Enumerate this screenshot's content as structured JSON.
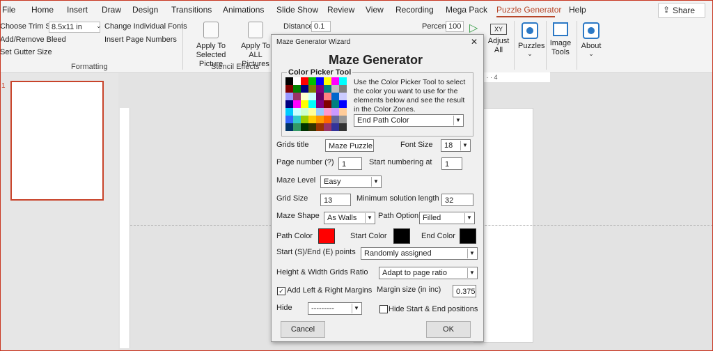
{
  "menubar": {
    "tabs": [
      "File",
      "Home",
      "Insert",
      "Draw",
      "Design",
      "Transitions",
      "Animations",
      "Slide Show",
      "Review",
      "View",
      "Recording",
      "Mega Pack",
      "Puzzle Generator",
      "Help"
    ],
    "active": "Puzzle Generator",
    "share": "Share"
  },
  "ribbon": {
    "trim_size_label": "Choose Trim Size",
    "trim_size_value": "8.5x11 in",
    "change_fonts": "Change Individual Fonts",
    "add_remove_bleed": "Add/Remove Bleed",
    "insert_page_numbers": "Insert Page Numbers",
    "set_gutter_size": "Set Gutter Size",
    "formatting_group": "Formatting",
    "apply_selected": "Apply To Selected Picture",
    "apply_all": "Apply To ALL Pictures",
    "stencil_group": "Stencil Effects",
    "distance_label": "Distance",
    "distance_value": "0.1",
    "percent_label": "Percent",
    "percent_value": "100",
    "adjust_all": "Adjust All",
    "xy_icon": "XY",
    "puzzles": "Puzzles",
    "image_tools": "Image Tools",
    "about": "About"
  },
  "slide_panel": {
    "number": "1"
  },
  "ruler": {
    "marks": "· 3 · · · 4"
  },
  "dialog": {
    "window_title": "Maze Generator Wizard",
    "close_glyph": "✕",
    "heading": "Maze Generator",
    "color_picker": {
      "group_label": "Color Picker Tool",
      "instructions": "Use the Color Picker Tool to select the color you want to use for the elements below and see the result in the Color Zones.",
      "target_value": "End Path Color"
    },
    "grids_title_label": "Grids title",
    "grids_title_value": "Maze Puzzle",
    "font_size_label": "Font Size",
    "font_size_value": "18",
    "page_number_label": "Page number (?)",
    "page_number_value": "1",
    "start_numbering_label": "Start numbering at",
    "start_numbering_value": "1",
    "maze_level_label": "Maze Level",
    "maze_level_value": "Easy",
    "grid_size_label": "Grid Size",
    "grid_size_value": "13",
    "min_solution_label": "Minimum solution length",
    "min_solution_value": "32",
    "maze_shape_label": "Maze Shape",
    "maze_shape_value": "As Walls",
    "path_option_label": "Path Option",
    "path_option_value": "Filled",
    "path_color_label": "Path Color",
    "path_color": "#ff0000",
    "start_color_label": "Start Color",
    "start_color": "#000000",
    "end_color_label": "End Color",
    "end_color": "#000000",
    "start_end_label": "Start (S)/End (E) points",
    "start_end_value": "Randomly assigned",
    "ratio_label": "Height & Width Grids Ratio",
    "ratio_value": "Adapt to page ratio",
    "margins_label": "Add Left & Right Margins",
    "margins_checked": "✓",
    "margin_size_label": "Margin size (in inc)",
    "margin_size_value": "0.375",
    "hide_label": "Hide",
    "hide_value": "---------",
    "hide_positions_label": "Hide Start & End positions",
    "cancel": "Cancel",
    "ok": "OK"
  },
  "palette_colors": [
    "#000000",
    "#ffffff",
    "#ff0000",
    "#00c000",
    "#0000ff",
    "#ffff00",
    "#ff00ff",
    "#00ffff",
    "#800000",
    "#008000",
    "#000080",
    "#808000",
    "#800080",
    "#008080",
    "#c0c0c0",
    "#808080",
    "#9999ff",
    "#993366",
    "#ffffcc",
    "#ccffff",
    "#660066",
    "#ff8080",
    "#0066cc",
    "#ccccff",
    "#000080",
    "#ff00ff",
    "#ffff00",
    "#00ffff",
    "#800080",
    "#800000",
    "#008080",
    "#0000ff",
    "#00ccff",
    "#ccffff",
    "#ccffcc",
    "#ffff99",
    "#99ccff",
    "#ff99cc",
    "#cc99ff",
    "#ffcc99",
    "#3366ff",
    "#33cccc",
    "#99cc00",
    "#ffcc00",
    "#ff9900",
    "#ff6600",
    "#666699",
    "#969696",
    "#003366",
    "#339966",
    "#003300",
    "#333300",
    "#993300",
    "#993366",
    "#333399",
    "#333333"
  ]
}
